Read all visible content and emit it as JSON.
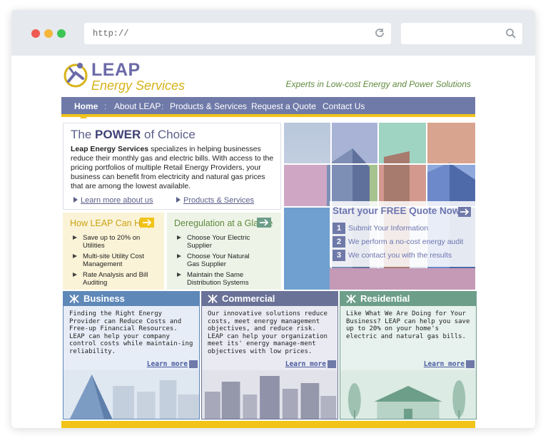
{
  "browser": {
    "url": "http://"
  },
  "brand": {
    "name": "LEAP",
    "sub": "Energy Services",
    "tagline": "Experts in Low-cost Energy and Power Solutions"
  },
  "nav": [
    "Home",
    "About LEAP",
    "Products & Services",
    "Request a Quote",
    "Contact Us"
  ],
  "power": {
    "title_pre": "The ",
    "title_em": "POWER",
    "title_post": " of Choice",
    "lead": "Leap Energy Services",
    "text": " specializes in helping businesses reduce their monthly gas and electric bills.  With access to the pricing portfolios of multiple Retail Energy Providers, your business can benefit from electricity and natural gas prices that are among the lowest available.",
    "link1": "Learn more about us",
    "link2": "Products & Services"
  },
  "help_box": {
    "title": "How LEAP Can Help",
    "items": [
      "Save up to 20% on Utilities",
      "Multi-site Utility Cost Management",
      "Rate Analysis and Bill Auditing"
    ]
  },
  "dereg_box": {
    "title": "Deregulation at a Glance",
    "items": [
      "Choose Your Electric Supplier",
      "Choose Your Natural Gas Supplier",
      "Maintain the Same Distribution Systems"
    ]
  },
  "quote": {
    "title": "Start your FREE Quote Now",
    "steps": [
      {
        "num": "1",
        "label": "Submit Your Information"
      },
      {
        "num": "2",
        "label": "We perform a no-cost energy audit"
      },
      {
        "num": "3",
        "label": "We contact you with the results"
      }
    ]
  },
  "cards": [
    {
      "title": "Business",
      "text": "Finding the Right Energy Provider can Reduce Costs and Free-up Financial Resources. LEAP can help your company control costs while maintain-ing reliability.",
      "link": "Learn more",
      "color": "#5e88b8"
    },
    {
      "title": "Commercial",
      "text": "Our innovative solutions reduce costs, meet energy management objectives, and reduce risk. LEAP can help your organization meet its' energy manage-ment objectives with low prices.",
      "link": "Learn more",
      "color": "#6b7298"
    },
    {
      "title": "Residential",
      "text": "Like What We Are Doing for Your Business? LEAP can help you save up to 20% on your home's electric and natural gas bills.",
      "link": "Learn more",
      "color": "#6d9e8a"
    }
  ],
  "colors": {
    "nav": "#6f7aa9",
    "accent": "#f2c318",
    "help_bg": "#fbf3d7",
    "dereg_bg": "#eef3e7"
  }
}
